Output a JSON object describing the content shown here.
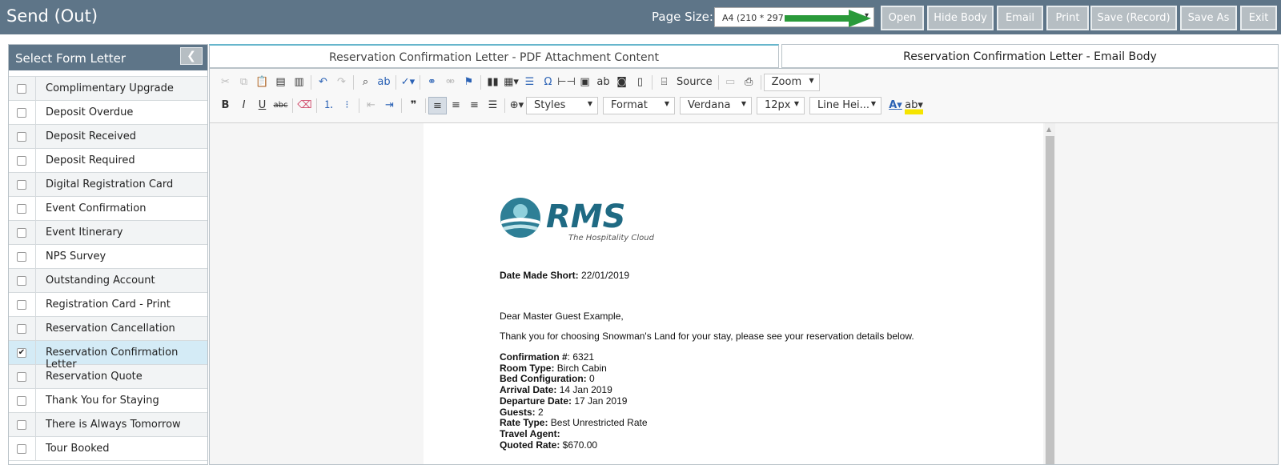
{
  "app": {
    "title": "Send (Out)",
    "page_size_label": "Page Size:",
    "page_size_value": "A4 (210 * 297"
  },
  "header_buttons": {
    "open": "Open",
    "hide_body": "Hide Body",
    "email": "Email",
    "print": "Print",
    "save_record": "Save (Record)",
    "save_as": "Save As",
    "exit": "Exit"
  },
  "sidebar": {
    "title": "Select Form Letter",
    "collapse_icon": "chevron-left-icon",
    "items": [
      {
        "label": "Complimentary Upgrade",
        "checked": false
      },
      {
        "label": "Deposit Overdue",
        "checked": false
      },
      {
        "label": "Deposit Received",
        "checked": false
      },
      {
        "label": "Deposit Required",
        "checked": false
      },
      {
        "label": "Digital Registration Card",
        "checked": false
      },
      {
        "label": "Event Confirmation",
        "checked": false
      },
      {
        "label": "Event Itinerary",
        "checked": false
      },
      {
        "label": "NPS Survey",
        "checked": false
      },
      {
        "label": "Outstanding Account",
        "checked": false
      },
      {
        "label": "Registration Card - Print",
        "checked": false
      },
      {
        "label": "Reservation Cancellation",
        "checked": false
      },
      {
        "label": "Reservation Confirmation Letter",
        "checked": true
      },
      {
        "label": "Reservation Quote",
        "checked": false
      },
      {
        "label": "Thank You for Staying",
        "checked": false
      },
      {
        "label": "There is Always Tomorrow",
        "checked": false
      },
      {
        "label": "Tour Booked",
        "checked": false
      }
    ]
  },
  "tabs": {
    "pdf": "Reservation Confirmation Letter - PDF Attachment Content",
    "email": "Reservation Confirmation Letter - Email Body"
  },
  "toolbar": {
    "source": "Source",
    "zoom": "Zoom",
    "styles": "Styles",
    "format": "Format",
    "font": "Verdana",
    "size": "12px",
    "line_height": "Line Hei...",
    "bold": "B",
    "italic": "I",
    "underline": "U",
    "strike": "abc",
    "quote": "❞",
    "text_color": "A"
  },
  "document": {
    "logo_text": "RMS",
    "logo_tagline": "The Hospitality Cloud",
    "date_label": "Date Made Short:",
    "date_value": "22/01/2019",
    "greeting": "Dear Master Guest Example,",
    "intro": "Thank you for choosing Snowman's Land for your stay, please see your reservation details below.",
    "details": [
      {
        "label": "Confirmation #",
        "value": ": 6321"
      },
      {
        "label": "Room Type:",
        "value": " Birch Cabin"
      },
      {
        "label": "Bed Configuration:",
        "value": " 0"
      },
      {
        "label": "Arrival Date:",
        "value": " 14 Jan 2019"
      },
      {
        "label": "Departure Date:",
        "value": " 17 Jan 2019"
      },
      {
        "label": "Guests:",
        "value": " 2"
      },
      {
        "label": "Rate Type:",
        "value": " Best Unrestricted Rate"
      },
      {
        "label": "Travel Agent:",
        "value": ""
      },
      {
        "label": "Quoted Rate:",
        "value": " $670.00"
      }
    ]
  },
  "colors": {
    "header_bg": "#5e7588",
    "button_bg": "#b6bec3",
    "selected_row": "#d4ebf6",
    "arrow": "#2a9a3a",
    "logo_teal": "#2e7f96"
  }
}
